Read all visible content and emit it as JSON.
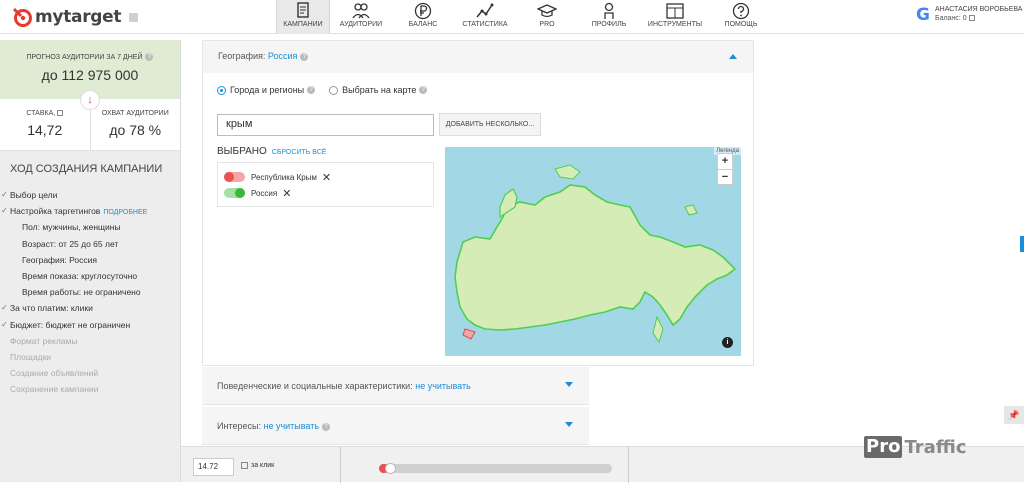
{
  "brand": {
    "logo_text": "mytarget",
    "logo_color": "#e63b2e"
  },
  "nav": [
    {
      "label": "КАМПАНИИ",
      "icon": "document-icon",
      "active": true
    },
    {
      "label": "АУДИТОРИИ",
      "icon": "people-icon"
    },
    {
      "label": "БАЛАНС",
      "icon": "ruble-icon"
    },
    {
      "label": "СТАТИСТИКА",
      "icon": "chart-icon"
    },
    {
      "label": "PRO",
      "icon": "graduation-cap-icon"
    },
    {
      "label": "ПРОФИЛЬ",
      "icon": "person-icon"
    },
    {
      "label": "ИНСТРУМЕНТЫ",
      "icon": "tools-icon"
    },
    {
      "label": "ПОМОЩЬ",
      "icon": "question-icon"
    }
  ],
  "user": {
    "google_glyph": "G",
    "name": "АНАСТАСИЯ ВОРОБЬЕВА",
    "balance": "Баланс: 0"
  },
  "sidebar": {
    "forecast_label": "ПРОГНОЗ АУДИТОРИИ ЗА 7 ДНЕЙ",
    "forecast_value": "до 112 975 000",
    "rate_label": "СТАВКА,",
    "rate_value": "14,72",
    "reach_label": "ОХВАТ АУДИТОРИИ",
    "reach_value": "до 78 %",
    "steps_title": "ХОД СОЗДАНИЯ КАМПАНИИ",
    "steps": [
      {
        "label": "Выбор цели"
      },
      {
        "label": "Настройка таргетингов",
        "link": "ПОДРОБНЕЕ"
      },
      {
        "label": "Пол: мужчины, женщины"
      },
      {
        "label": "Возраст: от 25 до 65 лет"
      },
      {
        "label": "География: Россия"
      },
      {
        "label": "Время показа: круглосуточно"
      },
      {
        "label": "Время работы: не ограничено"
      },
      {
        "label": "За что платим: клики"
      },
      {
        "label": "Бюджет: бюджет не ограничен"
      },
      {
        "label": "Формат рекламы"
      },
      {
        "label": "Площадки"
      },
      {
        "label": "Создание объявлений"
      },
      {
        "label": "Сохранение кампании"
      }
    ]
  },
  "geo": {
    "header_label": "География:",
    "header_value": "Россия",
    "radio1": "Города и регионы",
    "radio2": "Выбрать на карте",
    "search_value": "крым",
    "add_button": "ДОБАВИТЬ НЕСКОЛЬКО...",
    "selected_title": "ВЫБРАНО",
    "reset_link": "СБРОСИТЬ ВСЁ",
    "selected": [
      {
        "label": "Республика Крым",
        "state": "excluded"
      },
      {
        "label": "Россия",
        "state": "included"
      }
    ],
    "map_legend": "Легенда",
    "zoom_in": "+",
    "zoom_out": "−",
    "info": "i"
  },
  "behaviour": {
    "label": "Поведенческие и социальные характеристики:",
    "value": "не учитывать"
  },
  "interests": {
    "label": "Интересы:",
    "value": "не учитывать"
  },
  "bottom": {
    "bid_value": "14.72",
    "per_click": "за клик",
    "slider_fraction": 0.02
  },
  "watermark": {
    "pro": "Pro",
    "traffic": "Traffic"
  }
}
